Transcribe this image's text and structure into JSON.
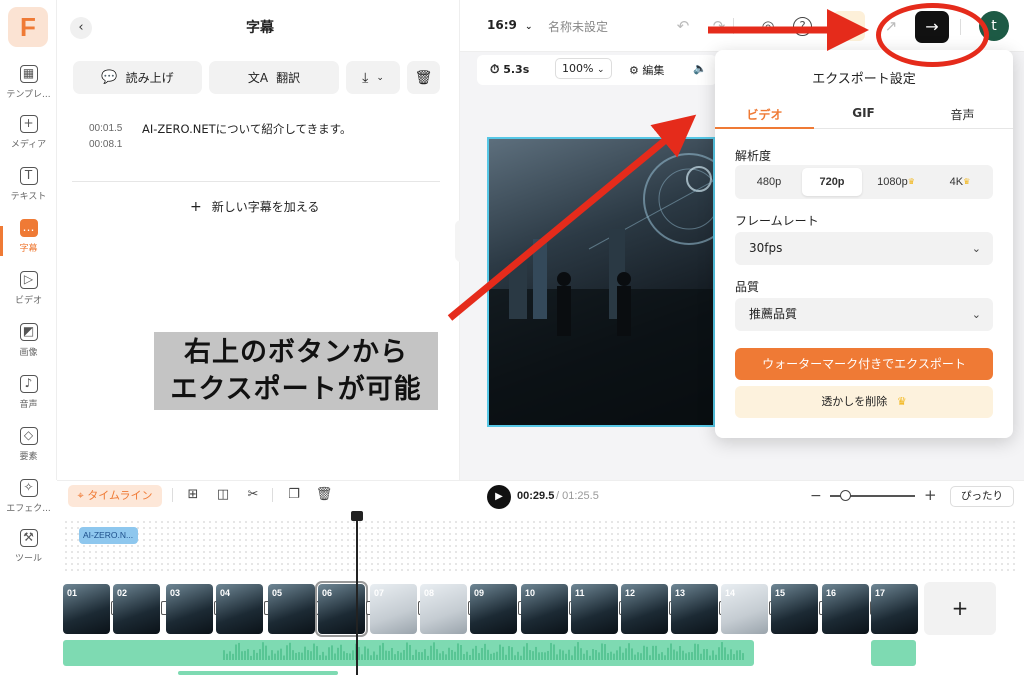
{
  "rail": {
    "items": [
      {
        "label": "テンプレ...",
        "icon": "template-icon",
        "glyph": "▦"
      },
      {
        "label": "メディア",
        "icon": "media-icon",
        "glyph": "+"
      },
      {
        "label": "テキスト",
        "icon": "text-icon",
        "glyph": "T"
      },
      {
        "label": "字幕",
        "icon": "subtitle-icon",
        "glyph": "…"
      },
      {
        "label": "ビデオ",
        "icon": "video-icon",
        "glyph": "▷"
      },
      {
        "label": "画像",
        "icon": "image-icon",
        "glyph": "◩"
      },
      {
        "label": "音声",
        "icon": "music-icon",
        "glyph": "♪"
      },
      {
        "label": "要素",
        "icon": "elements-icon",
        "glyph": "◇"
      },
      {
        "label": "エフェク...",
        "icon": "effects-icon",
        "glyph": "✧"
      },
      {
        "label": "ツール",
        "icon": "tools-icon",
        "glyph": "⚒"
      }
    ]
  },
  "panel": {
    "title": "字幕",
    "read_aloud": "読み上げ",
    "translate": "翻訳",
    "entry": {
      "start": "00:01.5",
      "end": "00:08.1",
      "text": "AI-ZERO.NETについて紹介してきます。"
    },
    "add_subtitle": "新しい字幕を加える"
  },
  "caption": {
    "line1": "右上のボタンから",
    "line2": "エクスポートが可能"
  },
  "topbar": {
    "ratio": "16:9",
    "project_name": "名称未設定",
    "avatar": "t"
  },
  "toolbar2": {
    "duration": "5.3s",
    "zoom": "100%",
    "edit": "編集"
  },
  "export_modal": {
    "title": "エクスポート設定",
    "tabs": [
      "ビデオ",
      "GIF",
      "音声"
    ],
    "resolution_label": "解析度",
    "resolutions": [
      "480p",
      "720p",
      "1080p",
      "4K"
    ],
    "resolution_selected": "720p",
    "framerate_label": "フレームレート",
    "framerate": "30fps",
    "quality_label": "品質",
    "quality": "推薦品質",
    "watermark_export": "ウォーターマーク付きでエクスポート",
    "remove_watermark": "透かしを削除"
  },
  "timeline": {
    "tab": "タイムライン",
    "time_current": "00:29.5",
    "time_total": "/ 01:25.5",
    "fit": "ぴったり",
    "subtitle_chip": "AI-ZERO.N...",
    "clips": [
      "01",
      "02",
      "03",
      "04",
      "05",
      "06",
      "07",
      "08",
      "09",
      "10",
      "11",
      "12",
      "13",
      "14",
      "15",
      "16",
      "17"
    ]
  },
  "colors": {
    "accent": "#ef7a35",
    "annotation_red": "#e52b1b"
  }
}
